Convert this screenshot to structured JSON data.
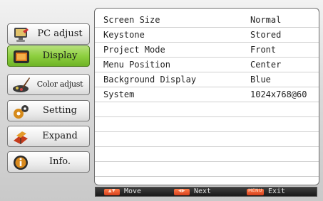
{
  "menu": {
    "items": [
      {
        "label": "PC adjust",
        "icon": "pc-adjust-icon"
      },
      {
        "label": "Display",
        "icon": "display-icon",
        "active": true
      },
      {
        "label": "Color adjust",
        "icon": "color-adjust-icon"
      },
      {
        "label": "Setting",
        "icon": "setting-icon"
      },
      {
        "label": "Expand",
        "icon": "expand-icon"
      },
      {
        "label": "Info.",
        "icon": "info-icon"
      }
    ]
  },
  "display_settings": {
    "rows": [
      {
        "name": "Screen Size",
        "value": "Normal"
      },
      {
        "name": "Keystone",
        "value": "Stored"
      },
      {
        "name": "Project Mode",
        "value": "Front"
      },
      {
        "name": "Menu Position",
        "value": "Center"
      },
      {
        "name": "Background Display",
        "value": " Blue"
      },
      {
        "name": "System",
        "value": "1024x768@60"
      }
    ]
  },
  "navbar": {
    "move_label": "Move",
    "next_label": "Next",
    "exit_label": "Exit"
  },
  "colors": {
    "active_menu": "#8dcf3f",
    "nav_key": "#d7401c",
    "navbar_bg": "#1a1a1a"
  }
}
